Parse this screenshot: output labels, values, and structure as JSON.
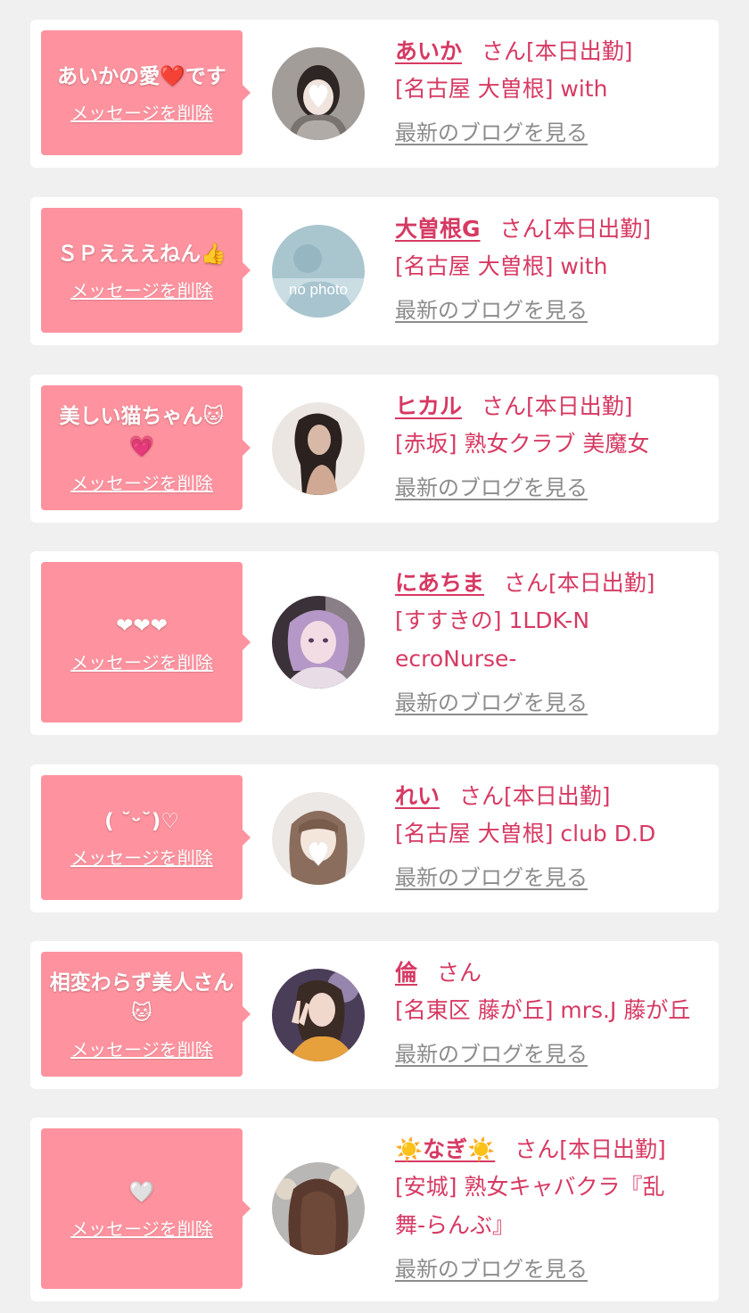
{
  "messages": [
    {
      "message": "あいかの愛❤️です",
      "delete_label": "メッセージを削除",
      "name": "あいか",
      "honorific": "さん",
      "status": "[本日出勤]",
      "shop": "[名古屋 大曽根] with",
      "blog_label": "最新のブログを見る",
      "avatar": "photo-heart-sticker"
    },
    {
      "message": "ＳＰえええねん👍",
      "delete_label": "メッセージを削除",
      "name": "大曽根G",
      "honorific": "さん",
      "status": "[本日出勤]",
      "shop": "[名古屋 大曽根] with",
      "blog_label": "最新のブログを見る",
      "avatar": "no-photo",
      "avatar_text": "no photo"
    },
    {
      "message": "美しい猫ちゃん🐱💗",
      "delete_label": "メッセージを削除",
      "name": "ヒカル",
      "honorific": "さん",
      "status": "[本日出勤]",
      "shop": "[赤坂] 熟女クラブ 美魔女",
      "blog_label": "最新のブログを見る",
      "avatar": "photo-woman-dark-hair"
    },
    {
      "message": "❤❤❤",
      "delete_label": "メッセージを削除",
      "name": "にあちま",
      "honorific": "さん",
      "status": "[本日出勤]",
      "shop": "[すすきの] 1LDK-NecroNurse-",
      "blog_label": "最新のブログを見る",
      "avatar": "photo-purple-hair"
    },
    {
      "message": "( ˘ᵕ˘)♡",
      "delete_label": "メッセージを削除",
      "name": "れい",
      "honorific": "さん",
      "status": "[本日出勤]",
      "shop": "[名古屋 大曽根] club D.D",
      "blog_label": "最新のブログを見る",
      "avatar": "photo-heart-sticker"
    },
    {
      "message": "相変わらず美人さん🐱",
      "delete_label": "メッセージを削除",
      "name": "倫",
      "honorific": "さん",
      "status": "",
      "shop": "[名東区 藤が丘] mrs.J 藤が丘",
      "blog_label": "最新のブログを見る",
      "avatar": "photo-peace-sign"
    },
    {
      "message": "🤍",
      "delete_label": "メッセージを削除",
      "name": "☀️なぎ☀️",
      "honorific": "さん",
      "status": "[本日出勤]",
      "shop": "[安城] 熟女キャバクラ『乱舞-らんぶ』",
      "blog_label": "最新のブログを見る",
      "avatar": "photo-back-of-head"
    }
  ],
  "colors": {
    "page_background": "#f0f0f0",
    "card_background": "#ffffff",
    "bubble_pink": "#fe939f",
    "accent_pink": "#d63a63",
    "link_gray": "#8c8c8c"
  }
}
